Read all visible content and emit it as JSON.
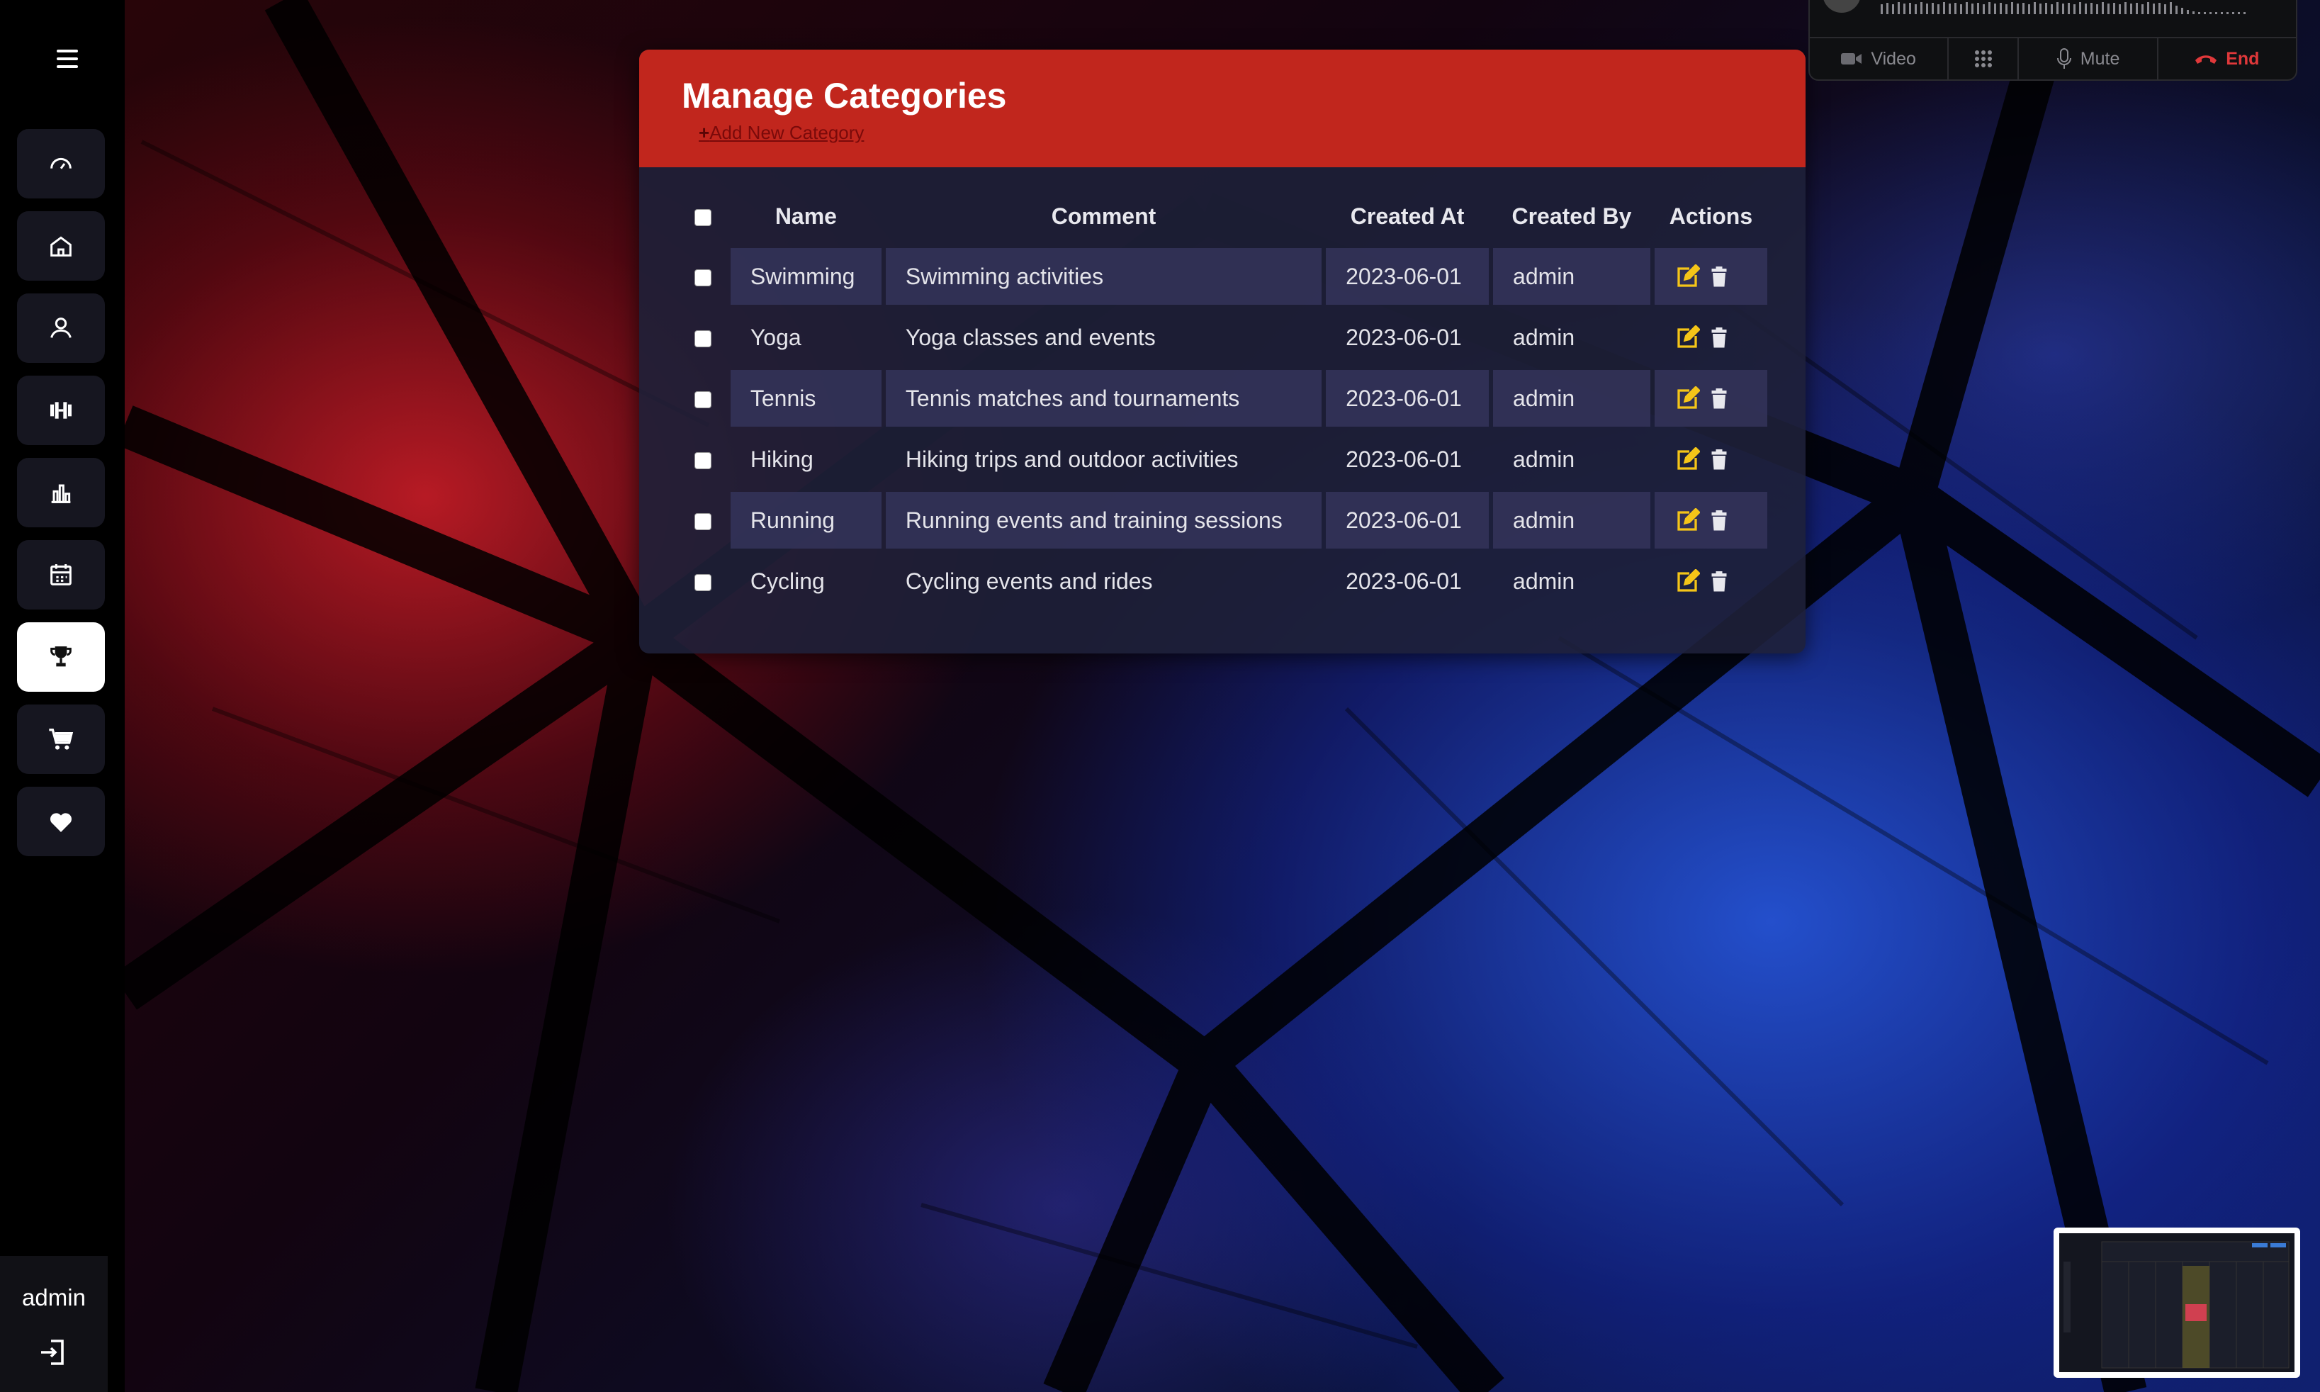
{
  "sidebar": {
    "items": [
      {
        "name": "dashboard",
        "icon": "gauge-icon",
        "active": false
      },
      {
        "name": "home",
        "icon": "home-icon",
        "active": false
      },
      {
        "name": "users",
        "icon": "user-icon",
        "active": false
      },
      {
        "name": "workouts",
        "icon": "dumbbell-icon",
        "active": false
      },
      {
        "name": "reports",
        "icon": "bar-chart-icon",
        "active": false
      },
      {
        "name": "calendar",
        "icon": "calendar-icon",
        "active": false
      },
      {
        "name": "competitions",
        "icon": "trophy-icon",
        "active": true
      },
      {
        "name": "shop",
        "icon": "cart-icon",
        "active": false
      },
      {
        "name": "favorites",
        "icon": "heart-icon",
        "active": false
      }
    ],
    "user": "admin"
  },
  "page": {
    "title": "Manage Categories",
    "add_link": "Add New Category",
    "add_icon": "+"
  },
  "table": {
    "columns": [
      "Name",
      "Comment",
      "Created At",
      "Created By",
      "Actions"
    ],
    "rows": [
      {
        "name": "Swimming",
        "comment": "Swimming activities",
        "created_at": "2023-06-01",
        "created_by": "admin"
      },
      {
        "name": "Yoga",
        "comment": "Yoga classes and events",
        "created_at": "2023-06-01",
        "created_by": "admin"
      },
      {
        "name": "Tennis",
        "comment": "Tennis matches and tournaments",
        "created_at": "2023-06-01",
        "created_by": "admin"
      },
      {
        "name": "Hiking",
        "comment": "Hiking trips and outdoor activities",
        "created_at": "2023-06-01",
        "created_by": "admin"
      },
      {
        "name": "Running",
        "comment": "Running events and training sessions",
        "created_at": "2023-06-01",
        "created_by": "admin"
      },
      {
        "name": "Cycling",
        "comment": "Cycling events and rides",
        "created_at": "2023-06-01",
        "created_by": "admin"
      }
    ]
  },
  "call_widget": {
    "video_label": "Video",
    "mute_label": "Mute",
    "end_label": "End"
  },
  "colors": {
    "header_red": "#c1261d",
    "edit_icon": "#f5c518",
    "end_red": "#e0383a"
  }
}
